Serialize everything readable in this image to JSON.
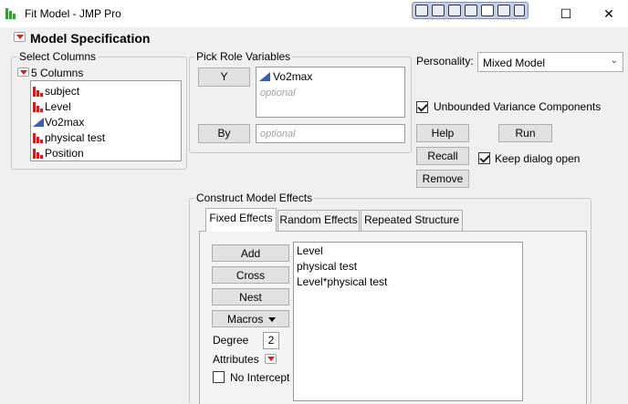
{
  "window": {
    "title": "Fit Model - JMP Pro",
    "controls": {
      "minimize": "—",
      "maximize": "☐",
      "close": "✕"
    }
  },
  "model_spec": {
    "title": "Model Specification"
  },
  "select_columns": {
    "label": "Select Columns",
    "count": "5 Columns",
    "columns": [
      {
        "name": "subject",
        "type": "nominal"
      },
      {
        "name": "Level",
        "type": "nominal"
      },
      {
        "name": "Vo2max",
        "type": "continuous"
      },
      {
        "name": "physical test",
        "type": "nominal"
      },
      {
        "name": "Position",
        "type": "nominal"
      }
    ]
  },
  "pick_role": {
    "label": "Pick Role Variables",
    "y_button": "Y",
    "y_value": "Vo2max",
    "y_placeholder": "optional",
    "by_button": "By",
    "by_placeholder": "optional"
  },
  "personality": {
    "label": "Personality:",
    "value": "Mixed Model"
  },
  "options": {
    "unbounded": "Unbounded Variance Components",
    "keep_open": "Keep dialog open"
  },
  "actions": {
    "help": "Help",
    "run": "Run",
    "recall": "Recall",
    "remove": "Remove"
  },
  "construct": {
    "label": "Construct Model Effects",
    "tabs": [
      "Fixed Effects",
      "Random Effects",
      "Repeated Structure"
    ],
    "add": "Add",
    "cross": "Cross",
    "nest": "Nest",
    "macros": "Macros",
    "degree_label": "Degree",
    "degree_value": "2",
    "attributes_label": "Attributes",
    "no_intercept": "No Intercept",
    "effects": [
      "Level",
      "physical test",
      "Level*physical test"
    ]
  },
  "colors": {
    "nominal": "#c62020",
    "continuous": "#3a5fb0",
    "red_triangle": "#d31f1f"
  }
}
